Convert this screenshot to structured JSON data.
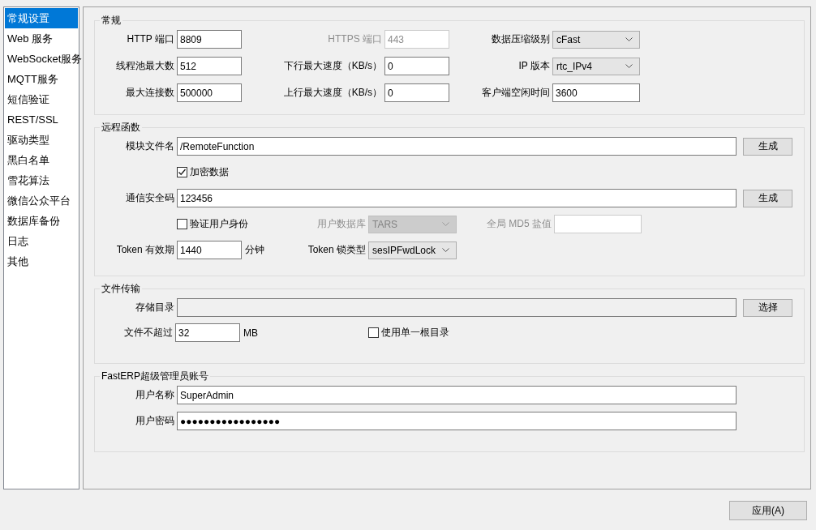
{
  "sidebar": {
    "items": [
      {
        "label": "常规设置",
        "selected": true
      },
      {
        "label": "Web 服务",
        "selected": false
      },
      {
        "label": "WebSocket服务",
        "selected": false
      },
      {
        "label": "MQTT服务",
        "selected": false
      },
      {
        "label": "短信验证",
        "selected": false
      },
      {
        "label": "REST/SSL",
        "selected": false
      },
      {
        "label": "驱动类型",
        "selected": false
      },
      {
        "label": "黑白名单",
        "selected": false
      },
      {
        "label": "雪花算法",
        "selected": false
      },
      {
        "label": "微信公众平台",
        "selected": false
      },
      {
        "label": "数据库备份",
        "selected": false
      },
      {
        "label": "日志",
        "selected": false
      },
      {
        "label": "其他",
        "selected": false
      }
    ]
  },
  "sections": [
    {
      "title": "常规",
      "rows": [
        [
          {
            "kind": "text",
            "label": "HTTP 端口",
            "value": "8809",
            "disabled": false
          },
          {
            "kind": "text",
            "label": "HTTPS 端口",
            "value": "443",
            "disabled": true
          },
          {
            "kind": "select",
            "label": "数据压缩级别",
            "value": "cFast",
            "disabled": false
          }
        ],
        [
          {
            "kind": "text",
            "label": "线程池最大数",
            "value": "512",
            "disabled": false
          },
          {
            "kind": "text",
            "label": "下行最大速度（KB/s）",
            "value": "0",
            "disabled": false
          },
          {
            "kind": "select",
            "label": "IP 版本",
            "value": "rtc_IPv4",
            "disabled": false
          }
        ],
        [
          {
            "kind": "text",
            "label": "最大连接数",
            "value": "500000",
            "disabled": false
          },
          {
            "kind": "text",
            "label": "上行最大速度（KB/s）",
            "value": "0",
            "disabled": false
          },
          {
            "kind": "text",
            "label": "客户端空闲时间",
            "value": "3600",
            "disabled": false
          }
        ]
      ]
    },
    {
      "title": "远程函数",
      "rows": [
        [
          {
            "kind": "text",
            "label": "模块文件名",
            "value": "/RemoteFunction",
            "disabled": false
          },
          {
            "kind": "button",
            "label": "生成"
          }
        ],
        [
          {
            "kind": "checkbox",
            "label": "加密数据",
            "checked": true
          }
        ],
        [
          {
            "kind": "text",
            "label": "通信安全码",
            "value": "123456",
            "disabled": false
          },
          {
            "kind": "button",
            "label": "生成"
          }
        ],
        [
          {
            "kind": "checkbox",
            "label": "验证用户身份",
            "checked": false
          },
          {
            "kind": "select",
            "label": "用户数据库",
            "value": "TARS",
            "disabled": true
          },
          {
            "kind": "text",
            "label": "全局 MD5 盐值",
            "disabled": true
          }
        ],
        [
          {
            "kind": "text",
            "label": "Token 有效期",
            "value": "1440",
            "unit": "分钟",
            "disabled": false
          },
          {
            "kind": "select",
            "label": "Token 锁类型",
            "value": "sesIPFwdLock",
            "disabled": false
          }
        ]
      ]
    },
    {
      "title": "文件传输",
      "rows": [
        [
          {
            "kind": "text",
            "label": "存储目录",
            "disabled": false,
            "readonly": true
          },
          {
            "kind": "button",
            "label": "选择"
          }
        ],
        [
          {
            "kind": "text",
            "label": "文件不超过",
            "value": "32",
            "unit": "MB",
            "disabled": false
          },
          {
            "kind": "checkbox",
            "label": "使用单一根目录",
            "checked": false
          }
        ]
      ]
    },
    {
      "title": "FastERP超级管理员账号",
      "rows": [
        [
          {
            "kind": "text",
            "label": "用户名称",
            "value": "SuperAdmin",
            "disabled": false
          }
        ],
        [
          {
            "kind": "password",
            "label": "用户密码",
            "value": "●●●●●●●●●●●●●●●●●",
            "disabled": false
          }
        ]
      ]
    }
  ],
  "apply_button": "应用(A)"
}
